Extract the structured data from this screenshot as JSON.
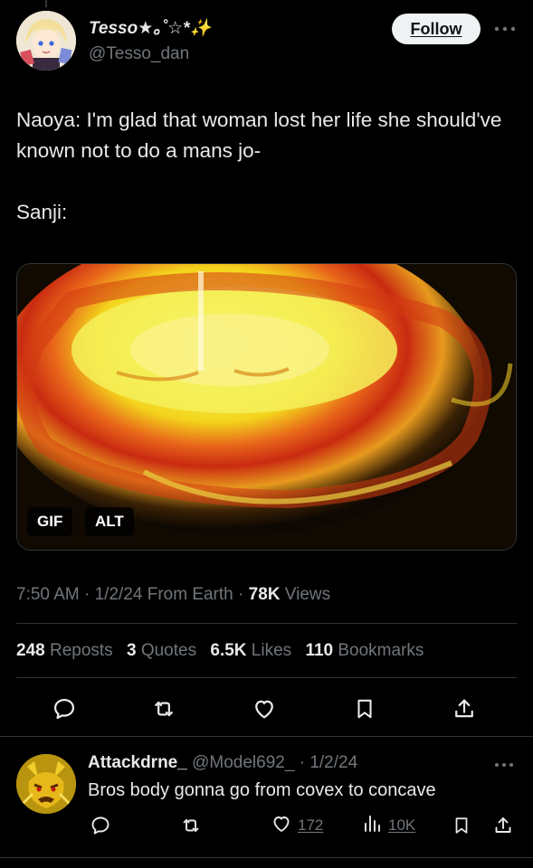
{
  "tweet": {
    "display_name": "Tesso★｡˚☆*✨",
    "handle": "@Tesso_dan",
    "follow_label": "Follow",
    "text": "Naoya: I'm glad that woman lost her life she should've known not to do a mans jo-\n\nSanji:",
    "media": {
      "gif_badge": "GIF",
      "alt_badge": "ALT"
    },
    "meta": {
      "time": "7:50 AM",
      "sep1": " · ",
      "date": "1/2/24",
      "source": " From Earth",
      "sep2": " · ",
      "views_count": "78K",
      "views_label": " Views"
    },
    "stats": {
      "reposts_count": "248",
      "reposts_label": " Reposts",
      "quotes_count": "3",
      "quotes_label": " Quotes",
      "likes_count": "6.5K",
      "likes_label": " Likes",
      "bookmarks_count": "110",
      "bookmarks_label": " Bookmarks"
    },
    "actions": [
      "reply-icon",
      "repost-icon",
      "like-icon",
      "bookmark-icon",
      "share-icon"
    ]
  },
  "reply": {
    "display_name": "Attackdrne_",
    "handle": " @Model692_",
    "separator": " · ",
    "date": "1/2/24",
    "text": "Bros body gonna go from covex to concave",
    "likes": "172",
    "views": "10K"
  },
  "colors": {
    "background": "#000000",
    "text_primary": "#e7e9ea",
    "text_secondary": "#71767b",
    "divider": "#2f3336",
    "follow_button_bg": "#eff3f4"
  }
}
